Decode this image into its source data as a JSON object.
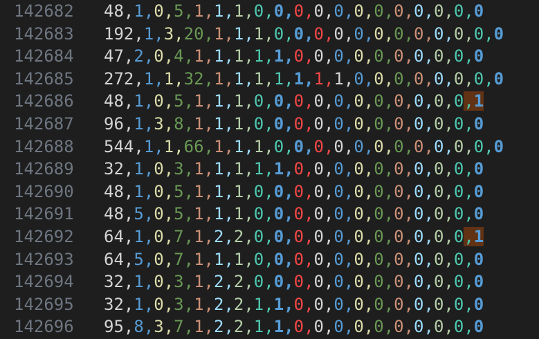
{
  "editor": {
    "highlight_color": "#613214",
    "column_colors": [
      "#d4d4d4",
      "#569cd6",
      "#dcdcaa",
      "#6a9955",
      "#ce9178",
      "#9cdcfe",
      "#b5cea8",
      "#4ec9b0",
      "#569cd6",
      "#f44747"
    ],
    "lines": [
      {
        "number": "142682",
        "text": "48,1,0,5,1,1,1,0,0,0,0,0,0,0,0,0,0,0,0",
        "highlight_last": false
      },
      {
        "number": "142683",
        "text": "192,1,3,20,1,1,1,0,0,0,0,0,0,0,0,0,0,0,0",
        "highlight_last": false
      },
      {
        "number": "142684",
        "text": "47,2,0,4,1,1,1,1,1,0,0,0,0,0,0,0,0,0,0",
        "highlight_last": false
      },
      {
        "number": "142685",
        "text": "272,1,1,32,1,1,1,1,1,1,1,0,0,0,0,0,0,0,0",
        "highlight_last": false
      },
      {
        "number": "142686",
        "text": "48,1,0,5,1,1,1,0,0,0,0,0,0,0,0,0,0,0,1",
        "highlight_last": true
      },
      {
        "number": "142687",
        "text": "96,1,3,8,1,1,1,0,0,0,0,0,0,0,0,0,0,0,0",
        "highlight_last": false
      },
      {
        "number": "142688",
        "text": "544,1,1,66,1,1,1,0,0,0,0,0,0,0,0,0,0,0,0",
        "highlight_last": false
      },
      {
        "number": "142689",
        "text": "32,1,0,3,1,1,1,1,1,0,0,0,0,0,0,0,0,0,0",
        "highlight_last": false
      },
      {
        "number": "142690",
        "text": "48,1,0,5,1,1,1,0,0,0,0,0,0,0,0,0,0,0,0",
        "highlight_last": false
      },
      {
        "number": "142691",
        "text": "48,5,0,5,1,1,1,0,0,0,0,0,0,0,0,0,0,0,0",
        "highlight_last": false
      },
      {
        "number": "142692",
        "text": "64,1,0,7,1,2,2,0,0,0,0,0,0,0,0,0,0,0,1",
        "highlight_last": true
      },
      {
        "number": "142693",
        "text": "64,5,0,7,1,1,1,0,0,0,0,0,0,0,0,0,0,0,0",
        "highlight_last": false
      },
      {
        "number": "142694",
        "text": "32,1,0,3,1,2,2,0,0,0,0,0,0,0,0,0,0,0,0",
        "highlight_last": false
      },
      {
        "number": "142695",
        "text": "32,1,0,3,1,2,2,1,1,0,0,0,0,0,0,0,0,0,0",
        "highlight_last": false
      },
      {
        "number": "142696",
        "text": "95,8,3,7,1,2,2,1,1,0,0,0,0,0,0,0,0,0,0",
        "highlight_last": false
      }
    ]
  }
}
